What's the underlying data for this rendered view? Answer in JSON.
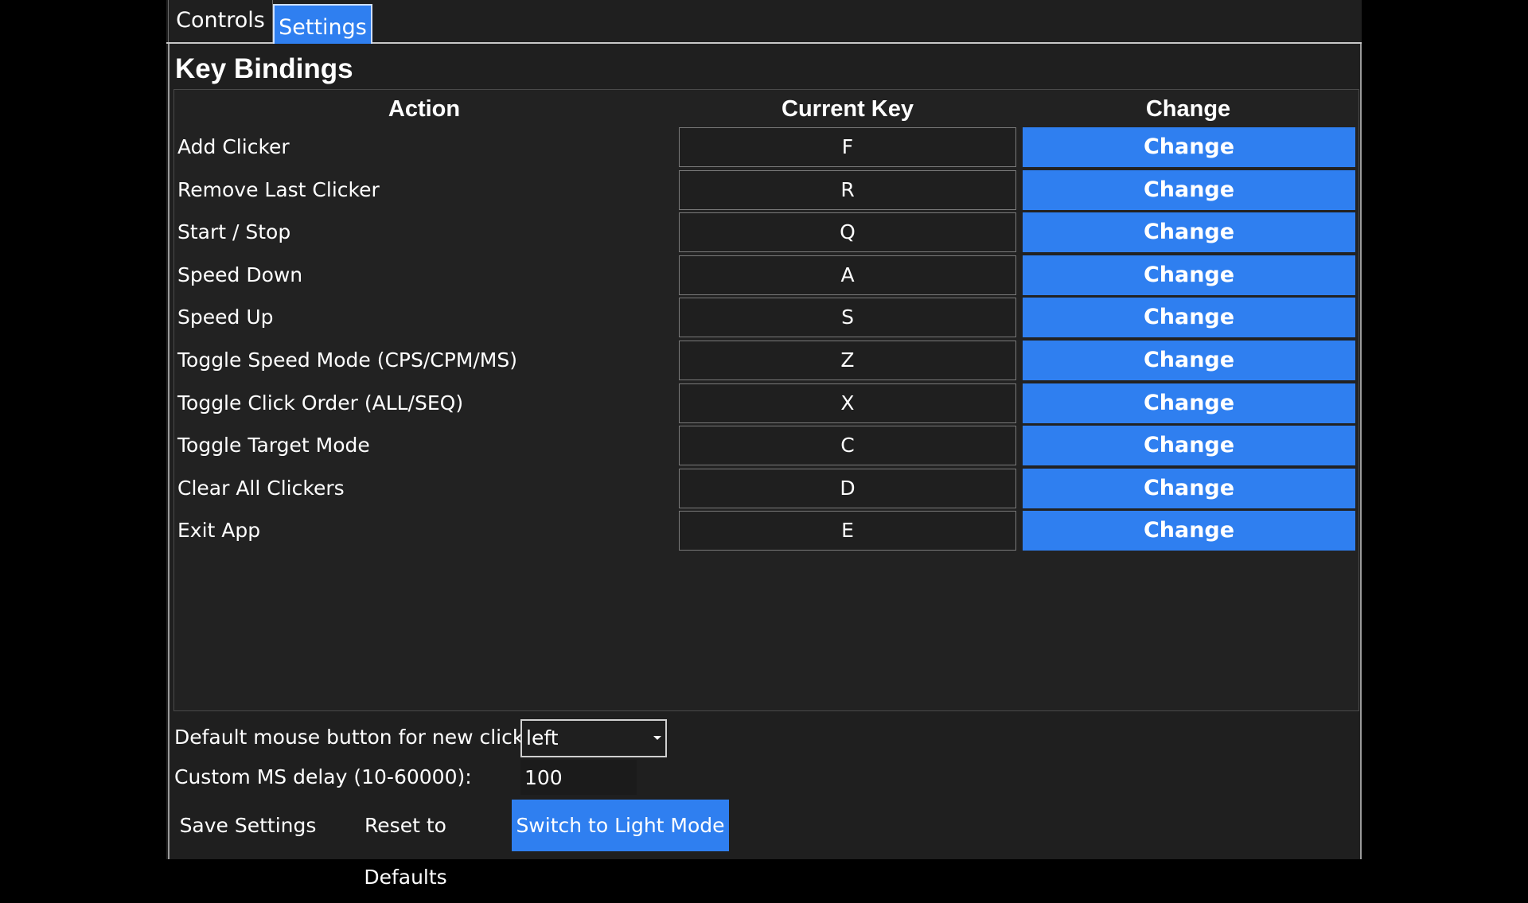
{
  "tabs": [
    {
      "label": "Controls",
      "active": false
    },
    {
      "label": "Settings",
      "active": true
    }
  ],
  "section_title": "Key Bindings",
  "columns": {
    "action": "Action",
    "current_key": "Current Key",
    "change": "Change"
  },
  "bindings": [
    {
      "action": "Add Clicker",
      "key": "F",
      "button": "Change"
    },
    {
      "action": "Remove Last Clicker",
      "key": "R",
      "button": "Change"
    },
    {
      "action": "Start / Stop",
      "key": "Q",
      "button": "Change"
    },
    {
      "action": "Speed Down",
      "key": "A",
      "button": "Change"
    },
    {
      "action": "Speed Up",
      "key": "S",
      "button": "Change"
    },
    {
      "action": "Toggle Speed Mode (CPS/CPM/MS)",
      "key": "Z",
      "button": "Change"
    },
    {
      "action": "Toggle Click Order (ALL/SEQ)",
      "key": "X",
      "button": "Change"
    },
    {
      "action": "Toggle Target Mode",
      "key": "C",
      "button": "Change"
    },
    {
      "action": "Clear All Clickers",
      "key": "D",
      "button": "Change"
    },
    {
      "action": "Exit App",
      "key": "E",
      "button": "Change"
    }
  ],
  "settings": {
    "mouse_button_label": "Default mouse button for new clickers:",
    "mouse_button_value": "left",
    "delay_label": "Custom MS delay (10-60000):",
    "delay_value": "100"
  },
  "buttons": {
    "save": "Save Settings",
    "reset": "Reset to Defaults",
    "theme": "Switch to Light Mode"
  },
  "colors": {
    "accent": "#2f7ff0",
    "background": "#1f1f1f"
  },
  "icons": {
    "dropdown": "chevron-down-icon"
  }
}
